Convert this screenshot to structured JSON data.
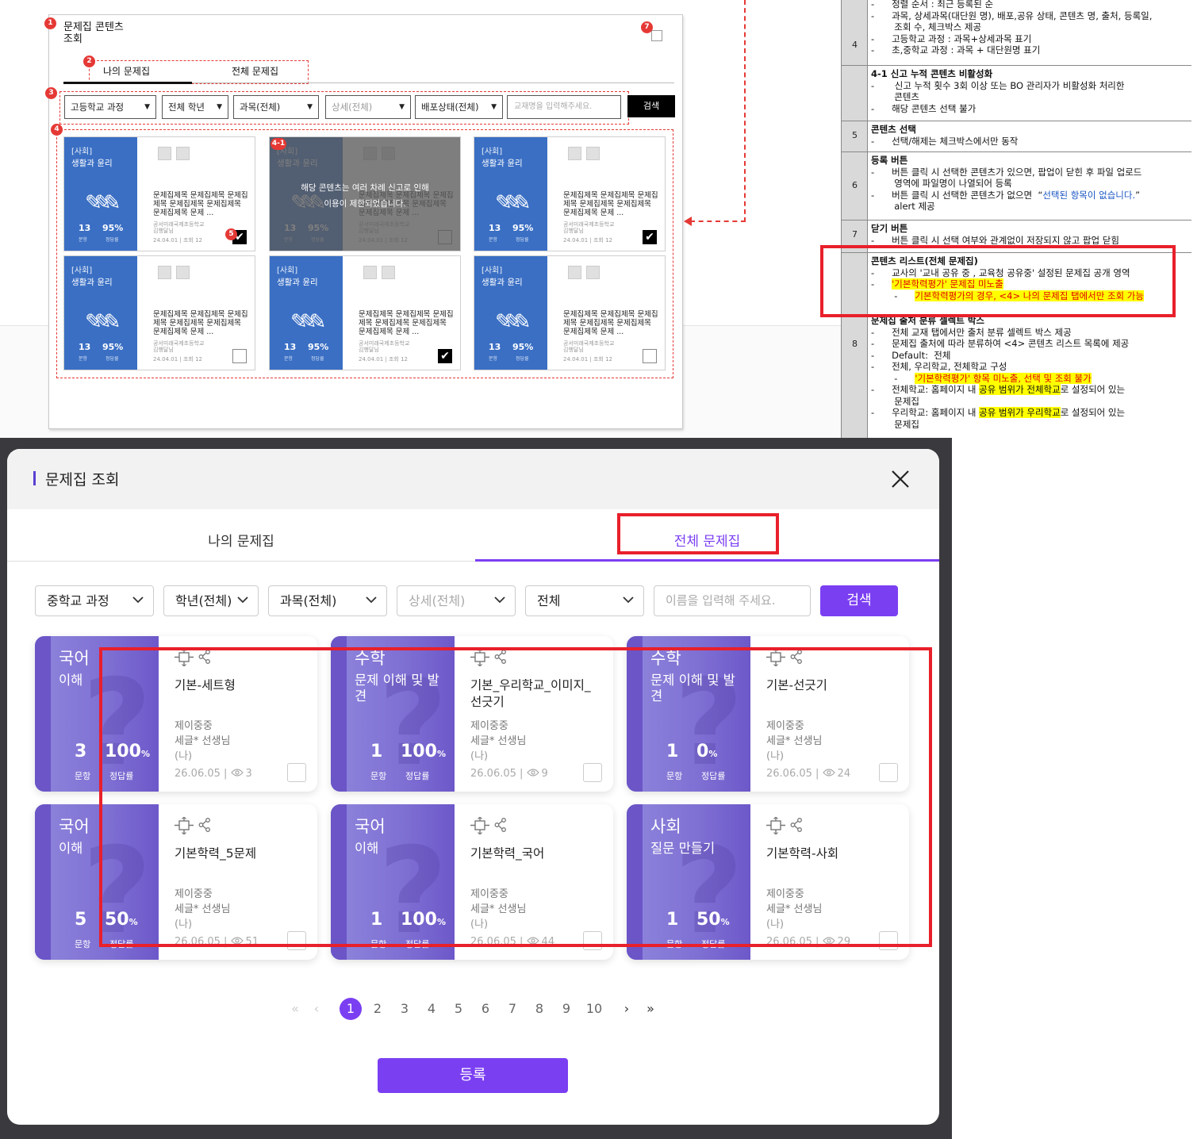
{
  "wireframe": {
    "title": "문제집 콘텐츠\n조회",
    "badges": {
      "b1": "1",
      "b2": "2",
      "b3": "3",
      "b4": "4",
      "b41": "4-1",
      "b5": "5",
      "b7": "7"
    },
    "tabs": [
      "나의 문제집",
      "전체 문제집"
    ],
    "filters": [
      "고등학교 과정",
      "전체 학년",
      "과목(전체)",
      "상세(전체)",
      "배포상태(전체)"
    ],
    "search_placeholder": "교재명을 입력해주세요.",
    "search_button": "검색",
    "blocked_message": "해당 콘텐츠는 여러 차례 신고로 인해\n이용이 제한되었습니다.",
    "cards": [
      {
        "category": "[사회]",
        "subject": "생활과 윤리",
        "count": "13",
        "rate": "95%",
        "count_label": "문항",
        "rate_label": "정답률",
        "desc": "문제집제목 문제집제목 문제집제목 문제집제목 문제집제목 문제집제목 문제 ...",
        "school": "공서미래국제초등학교\n김행달님",
        "meta": "24.04.01 | 조회 12",
        "checked": true
      },
      {
        "category": "[사회]",
        "subject": "생활과 윤리",
        "count": "13",
        "rate": "95%",
        "count_label": "문항",
        "rate_label": "정답률",
        "desc": "문제집제목 문제집제목 문제집제목 문제집제목 문제집제목 문제집제목 문제 ...",
        "school": "공서미래국제초등학교\n김행달님",
        "meta": "24.04.01 | 조회 12",
        "checked": false
      },
      {
        "category": "[사회]",
        "subject": "생활과 윤리",
        "count": "13",
        "rate": "95%",
        "count_label": "문항",
        "rate_label": "정답률",
        "desc": "문제집제목 문제집제목 문제집제목 문제집제목 문제집제목 문제집제목 문제 ...",
        "school": "공서미래국제초등학교\n김행달님",
        "meta": "24.04.01 | 조회 12",
        "checked": true
      },
      {
        "category": "[사회]",
        "subject": "생활과 윤리",
        "count": "13",
        "rate": "95%",
        "count_label": "문항",
        "rate_label": "정답률",
        "desc": "문제집제목 문제집제목 문제집제목 문제집제목 문제집제목 문제집제목 문제 ...",
        "school": "공서미래국제초등학교\n김행달님",
        "meta": "24.04.01 | 조회 12",
        "checked": false
      },
      {
        "category": "[사회]",
        "subject": "생활과 윤리",
        "count": "13",
        "rate": "95%",
        "count_label": "문항",
        "rate_label": "정답률",
        "desc": "문제집제목 문제집제목 문제집제목 문제집제목 문제집제목 문제집제목 문제 ...",
        "school": "공서미래국제초등학교\n김행달님",
        "meta": "24.04.01 | 조회 12",
        "checked": true
      },
      {
        "category": "[사회]",
        "subject": "생활과 윤리",
        "count": "13",
        "rate": "95%",
        "count_label": "문항",
        "rate_label": "정답률",
        "desc": "문제집제목 문제집제목 문제집제목 문제집제목 문제집제목 문제집제목 문제 ...",
        "school": "공서미래국제초등학교\n김행달님",
        "meta": "24.04.01 | 조회 12",
        "checked": false
      }
    ]
  },
  "spec": {
    "r4_num": "4",
    "r4_lines": [
      "-      정렬 순서 : 최근 등록된 순",
      "-      과목, 상세과목(대단원 명), 배포,공유 상태, 콘텐츠 명, 출처, 등록일,",
      "        조회 수, 체크박스 제공",
      "-      고등학교 과정 : 과목+상세과목 표기",
      "-      초,중학교 과정 : 과목 + 대단원명 표기"
    ],
    "r41_title": "4-1 신고 누적 콘텐츠 비활성화",
    "r41_lines": [
      "-       신고 누적 횟수 3회 이상 또는 BO 관리자가 비활성화 처리한",
      "        콘텐츠",
      "-      해당 콘텐츠 선택 불가"
    ],
    "r5_num": "5",
    "r5_title": "콘텐츠 선택",
    "r5_line": "-      선택/해제는 체크박스에서만 동작",
    "r6_num": "6",
    "r6_title": "등록 버튼",
    "r6_l1": "-      버튼 클릭 시 선택한 콘텐츠가 있으면, 팝업이 닫힌 후 파일 업로드",
    "r6_l2": "        영역에 파일명이 나열되어 등록",
    "r6_l3a": "-      버튼 클릭 시 선택한 콘텐츠가 없으면  “",
    "r6_l3b": "선택된 항목이 없습니다.",
    "r6_l3c": "”",
    "r6_l4": "        alert 제공",
    "r7_num": "7",
    "r7_title": "닫기 버튼",
    "r7_line": "-      버튼 클릭 시 선택 여부와 관계없이 저장되지 않고 팝업 닫힘",
    "rx_title": "콘텐츠 리스트(전체 문제집)",
    "rx_l1": "-      교사의 '교내 공유 중 , 교육청 공유중' 설정된 문제집 공개 영역",
    "rx_l2a": "-      ",
    "rx_l2b": "'기본학력평가' 문제집 미노출",
    "rx_l3a": "        -      ",
    "rx_l3b": "기본학력평가의 경우, <4> 나의 문제집 탭에서만 조회 가능",
    "r8_num": "8",
    "r8_title": "문제집 출처 분류 셀렉트 박스",
    "r8_l1": "-      전체 교재 탭에서만 출처 분류 셀렉트 박스 제공",
    "r8_l2": "-      문제집 출처에 따라 분류하여 <4> 콘텐츠 리스트 목록에 제공",
    "r8_l3": "-      Default:  전체",
    "r8_l4": "-      전체, 우리학교, 전체학교 구성",
    "r8_l5a": "        -      ",
    "r8_l5b": "'기본학력평가' 항목 미노출, 선택 및 조회 불가",
    "r8_l6a": "-      전체학교: 홈페이지 내 ",
    "r8_l6b": "공유 범위가 전체학교",
    "r8_l6c": "로 설정되어 있는",
    "r8_l7": "        문제집",
    "r8_l8a": "-      우리학교: 홈페이지 내 ",
    "r8_l8b": "공유 범위가 우리학교",
    "r8_l8c": "로 설정되어 있는",
    "r8_l9": "        문제집"
  },
  "modal": {
    "title": "문제집 조회",
    "tabs": {
      "mine": "나의 문제집",
      "all": "전체 문제집"
    },
    "filters": {
      "course": "중학교 과정",
      "grade": "학년(전체)",
      "subject": "과목(전체)",
      "detail": "상세(전체)",
      "source": "전체"
    },
    "search_placeholder": "이름을 입력해 주세요.",
    "search_button": "검색",
    "cards": [
      {
        "subject": "국어",
        "sub": "이해",
        "count": "3",
        "rate": "100",
        "unit": "%",
        "count_label": "문항",
        "rate_label": "정답률",
        "name": "기본-세트형",
        "school": "제이중중",
        "teacher": "세글* 선생님",
        "me": "(나)",
        "date": "26.06.05 | ",
        "views": "3"
      },
      {
        "subject": "수학",
        "sub": "문제 이해 및 발견",
        "count": "1",
        "rate": "100",
        "unit": "%",
        "count_label": "문항",
        "rate_label": "정답률",
        "name": "기본_우리학교_이미지_선긋기",
        "school": "제이중중",
        "teacher": "세글* 선생님",
        "me": "(나)",
        "date": "26.06.05 | ",
        "views": "9"
      },
      {
        "subject": "수학",
        "sub": "문제 이해 및 발견",
        "count": "1",
        "rate": "0",
        "unit": "%",
        "count_label": "문항",
        "rate_label": "정답률",
        "name": "기본-선긋기",
        "school": "제이중중",
        "teacher": "세글* 선생님",
        "me": "(나)",
        "date": "26.06.05 | ",
        "views": "24"
      },
      {
        "subject": "국어",
        "sub": "이해",
        "count": "5",
        "rate": "50",
        "unit": "%",
        "count_label": "문항",
        "rate_label": "정답률",
        "name": "기본학력_5문제",
        "school": "제이중중",
        "teacher": "세글* 선생님",
        "me": "(나)",
        "date": "26.06.05 | ",
        "views": "51"
      },
      {
        "subject": "국어",
        "sub": "이해",
        "count": "1",
        "rate": "100",
        "unit": "%",
        "count_label": "문항",
        "rate_label": "정답률",
        "name": "기본학력_국어",
        "school": "제이중중",
        "teacher": "세글* 선생님",
        "me": "(나)",
        "date": "26.06.05 | ",
        "views": "44"
      },
      {
        "subject": "사회",
        "sub": "질문 만들기",
        "count": "1",
        "rate": "50",
        "unit": "%",
        "count_label": "문항",
        "rate_label": "정답률",
        "name": "기본학력-사회",
        "school": "제이중중",
        "teacher": "세글* 선생님",
        "me": "(나)",
        "date": "26.06.05 | ",
        "views": "29"
      }
    ],
    "pagination": {
      "first": "«",
      "prev": "‹",
      "pages": [
        "1",
        "2",
        "3",
        "4",
        "5",
        "6",
        "7",
        "8",
        "9",
        "10"
      ],
      "current": "1",
      "next": "›",
      "last": "»"
    },
    "register_button": "등록"
  },
  "colors": {
    "accent": "#7b3ff2",
    "annotation_red": "#e8202b",
    "wire_blue": "#3a6fc4"
  }
}
